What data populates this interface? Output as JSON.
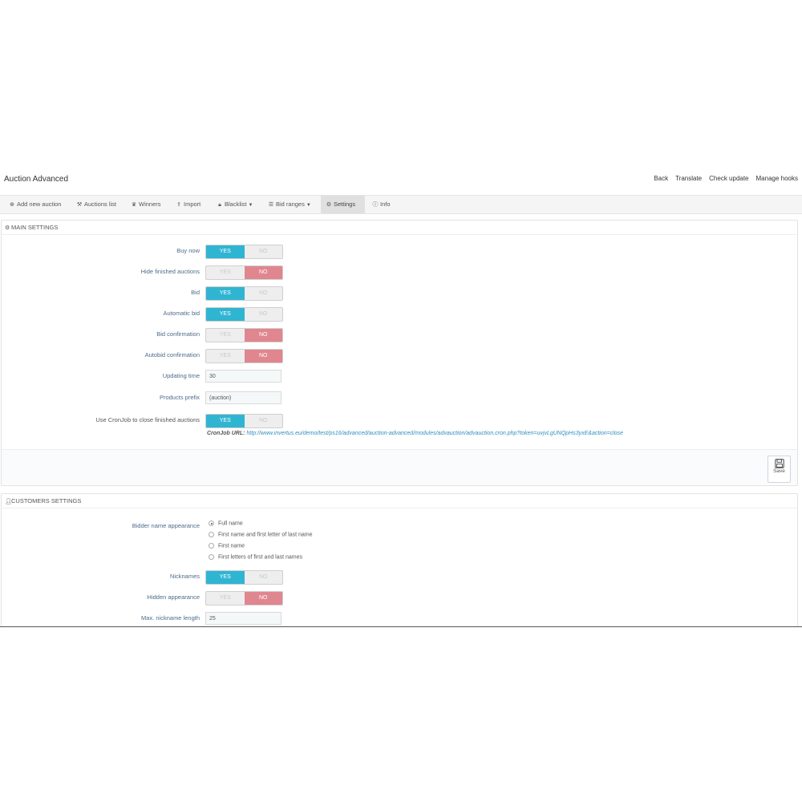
{
  "app": {
    "title": "Auction Advanced"
  },
  "toplinks": [
    "Back",
    "Translate",
    "Check update",
    "Manage hooks"
  ],
  "tabs": [
    {
      "label": "Add new auction",
      "icon": "plus-circle-icon"
    },
    {
      "label": "Auctions list",
      "icon": "gavel-icon"
    },
    {
      "label": "Winners",
      "icon": "trophy-icon"
    },
    {
      "label": "Import",
      "icon": "upload-icon"
    },
    {
      "label": "Blacklist",
      "icon": "lock-icon"
    },
    {
      "label": "Bid ranges",
      "icon": "list-icon"
    },
    {
      "label": "Settings",
      "icon": "gears-icon"
    },
    {
      "label": "Info",
      "icon": "info-icon"
    }
  ],
  "main": {
    "title": "MAIN SETTINGS",
    "rows": {
      "buy_now": {
        "label": "Buy now",
        "value": "YES"
      },
      "hide_finished": {
        "label": "Hide finished auctions",
        "value": "NO"
      },
      "bid": {
        "label": "Bid",
        "value": "YES"
      },
      "automatic_bid": {
        "label": "Automatic bid",
        "value": "YES"
      },
      "bid_confirmation": {
        "label": "Bid confirmation",
        "value": "NO"
      },
      "autobid_confirmation": {
        "label": "Autobid confirmation",
        "value": "NO"
      },
      "updating_time": {
        "label": "Updating time",
        "value": "30"
      },
      "products_prefix": {
        "label": "Products prefix",
        "value": "(auction)"
      },
      "cronjob": {
        "label": "Use CronJob to close finished auctions",
        "value": "YES"
      }
    },
    "cron_label": "CronJob URL:",
    "cron_url": "http://www.invertus.eu/demo/test/ps16/advanced/auction-advanced/modules/advauction/advauction.cron.php?token=uvjvLgUNQpHs3yxE&action=close",
    "save_label": "Save"
  },
  "customers": {
    "title": "CUSTOMERS SETTINGS",
    "bidder_label": "Bidder name appearance",
    "bidder_options": [
      "Full name",
      "First name and first letter of last name",
      "First name",
      "First letters of first and last names"
    ],
    "bidder_selected": 0,
    "rows": {
      "nicknames": {
        "label": "Nicknames",
        "value": "YES"
      },
      "hidden_appearance": {
        "label": "Hidden appearance",
        "value": "NO"
      },
      "max_nickname": {
        "label": "Max. nickname length",
        "value": "25"
      }
    }
  },
  "switch_labels": {
    "yes": "YES",
    "no": "NO"
  },
  "colors": {
    "yes": "#2fb5d2",
    "no": "#e0868f"
  }
}
